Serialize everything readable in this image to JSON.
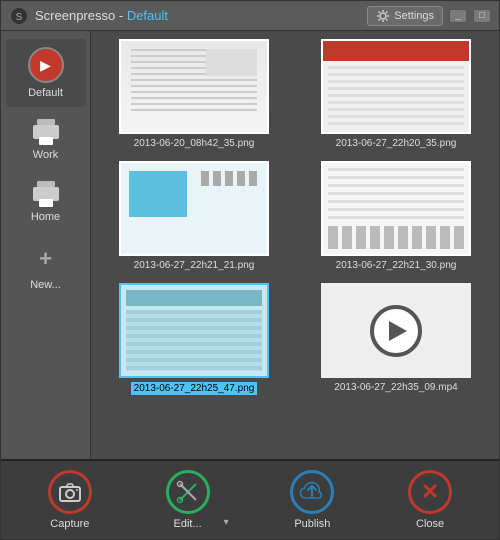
{
  "titlebar": {
    "logo_icon": "screenpresso-logo",
    "title": "Screenpresso",
    "separator": "-",
    "default_label": "Default",
    "settings_label": "Settings",
    "minimize_label": "_",
    "restore_label": "□"
  },
  "sidebar": {
    "items": [
      {
        "id": "default",
        "label": "Default",
        "icon": "default-icon",
        "active": true
      },
      {
        "id": "work",
        "label": "Work",
        "icon": "work-printer-icon",
        "active": false
      },
      {
        "id": "home",
        "label": "Home",
        "icon": "home-printer-icon",
        "active": false
      },
      {
        "id": "new",
        "label": "New...",
        "icon": "plus-icon",
        "active": false
      }
    ]
  },
  "grid": {
    "items": [
      {
        "id": "ss1",
        "filename": "2013-06-20_08h42_35.png",
        "type": "image",
        "thumb": "ss1",
        "selected": false
      },
      {
        "id": "ss2",
        "filename": "2013-06-27_22h20_35.png",
        "type": "image",
        "thumb": "ss2",
        "selected": false
      },
      {
        "id": "ss3",
        "filename": "2013-06-27_22h21_21.png",
        "type": "image",
        "thumb": "ss3",
        "selected": false
      },
      {
        "id": "ss4",
        "filename": "2013-06-27_22h21_30.png",
        "type": "image",
        "thumb": "ss4",
        "selected": false
      },
      {
        "id": "ss5",
        "filename": "2013-06-27_22h25_47.png",
        "type": "image",
        "thumb": "ss5",
        "selected": true
      },
      {
        "id": "video1",
        "filename": "2013-06-27_22h35_09.mp4",
        "type": "video",
        "thumb": "video",
        "selected": false
      }
    ]
  },
  "toolbar": {
    "capture_label": "Capture",
    "edit_label": "Edit...",
    "publish_label": "Publish",
    "close_label": "Close"
  }
}
